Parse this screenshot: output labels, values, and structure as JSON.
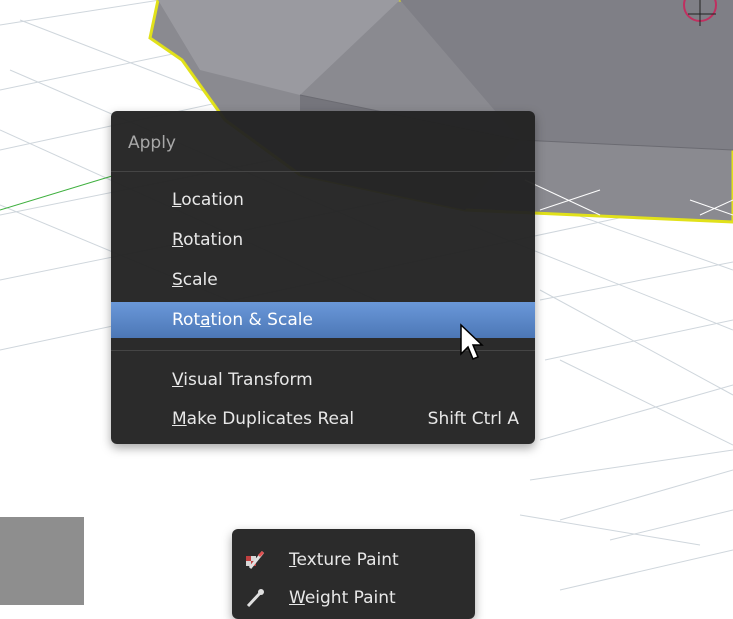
{
  "apply_menu": {
    "title": "Apply",
    "items": [
      {
        "label": "Location",
        "underline": "L",
        "rest": "ocation",
        "shortcut": ""
      },
      {
        "label": "Rotation",
        "underline": "R",
        "rest": "otation",
        "shortcut": ""
      },
      {
        "label": "Scale",
        "underline": "S",
        "rest": "cale",
        "shortcut": ""
      },
      {
        "label": "Rotation & Scale",
        "pre": "Rot",
        "underline": "a",
        "rest": "tion & Scale",
        "shortcut": "",
        "active": true
      },
      {
        "label": "Visual Transform",
        "underline": "V",
        "rest": "isual Transform",
        "shortcut": ""
      },
      {
        "label": "Make Duplicates Real",
        "underline": "M",
        "rest": "ake Duplicates Real",
        "shortcut": "Shift Ctrl A"
      }
    ]
  },
  "mode_menu": {
    "items": [
      {
        "label": "Texture Paint",
        "underline": "T",
        "rest": "exture Paint",
        "icon": "texture-paint-icon"
      },
      {
        "label": "Weight Paint",
        "underline": "W",
        "rest": "eight Paint",
        "icon": "weight-paint-icon"
      }
    ]
  },
  "colors": {
    "menu_bg": "#222222",
    "highlight": "#5680c2",
    "mesh_outline": "#e1e11a",
    "x_axis": "#cc3333",
    "y_axis": "#3fb03f"
  }
}
